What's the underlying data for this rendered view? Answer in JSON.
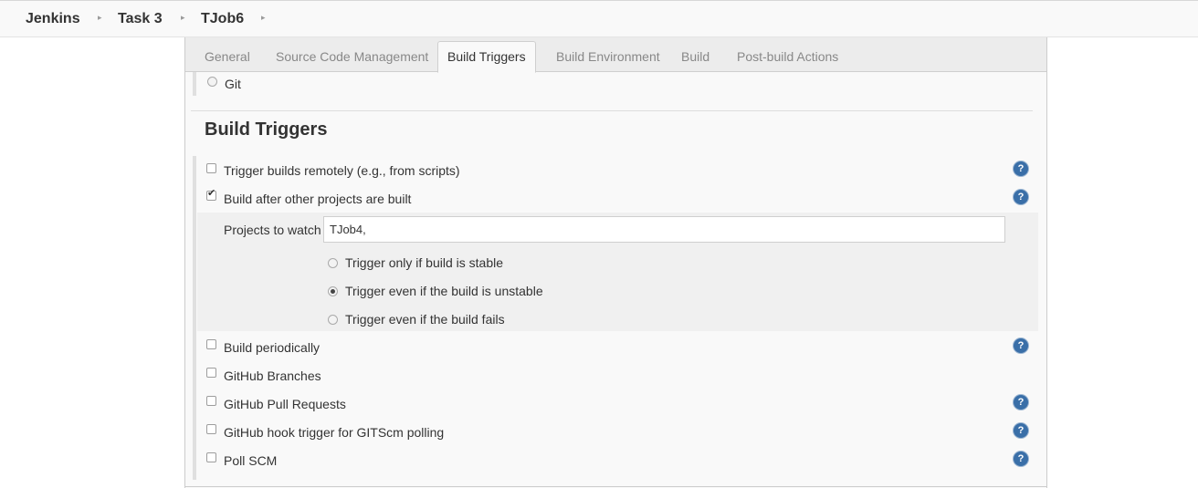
{
  "breadcrumb": {
    "items": [
      "Jenkins",
      "Task 3",
      "TJob6"
    ],
    "separator": "▸"
  },
  "tabs": [
    {
      "label": "General",
      "active": false
    },
    {
      "label": "Source Code Management",
      "active": false
    },
    {
      "label": "Build Triggers",
      "active": true
    },
    {
      "label": "Build Environment",
      "active": false
    },
    {
      "label": "Build",
      "active": false
    },
    {
      "label": "Post-build Actions",
      "active": false
    }
  ],
  "scm": {
    "git_label": "Git"
  },
  "build_triggers": {
    "title": "Build Triggers",
    "help_icon": "?",
    "options": [
      {
        "label": "Trigger builds remotely (e.g., from scripts)",
        "checked": false
      },
      {
        "label": "Build after other projects are built",
        "checked": true
      },
      {
        "label": "Build periodically",
        "checked": false
      },
      {
        "label": "GitHub Branches",
        "checked": false
      },
      {
        "label": "GitHub Pull Requests",
        "checked": false
      },
      {
        "label": "GitHub hook trigger for GITScm polling",
        "checked": false
      },
      {
        "label": "Poll SCM",
        "checked": false
      }
    ],
    "projects_to_watch": {
      "label": "Projects to watch",
      "value": "TJob4,"
    },
    "trigger_conditions": [
      {
        "label": "Trigger only if build is stable",
        "selected": false
      },
      {
        "label": "Trigger even if the build is unstable",
        "selected": true
      },
      {
        "label": "Trigger even if the build fails",
        "selected": false
      }
    ]
  },
  "colors": {
    "help_icon": "#3a6fa8",
    "panel_bg": "#f9f9f9",
    "nested_bg": "#f0f0f0"
  }
}
